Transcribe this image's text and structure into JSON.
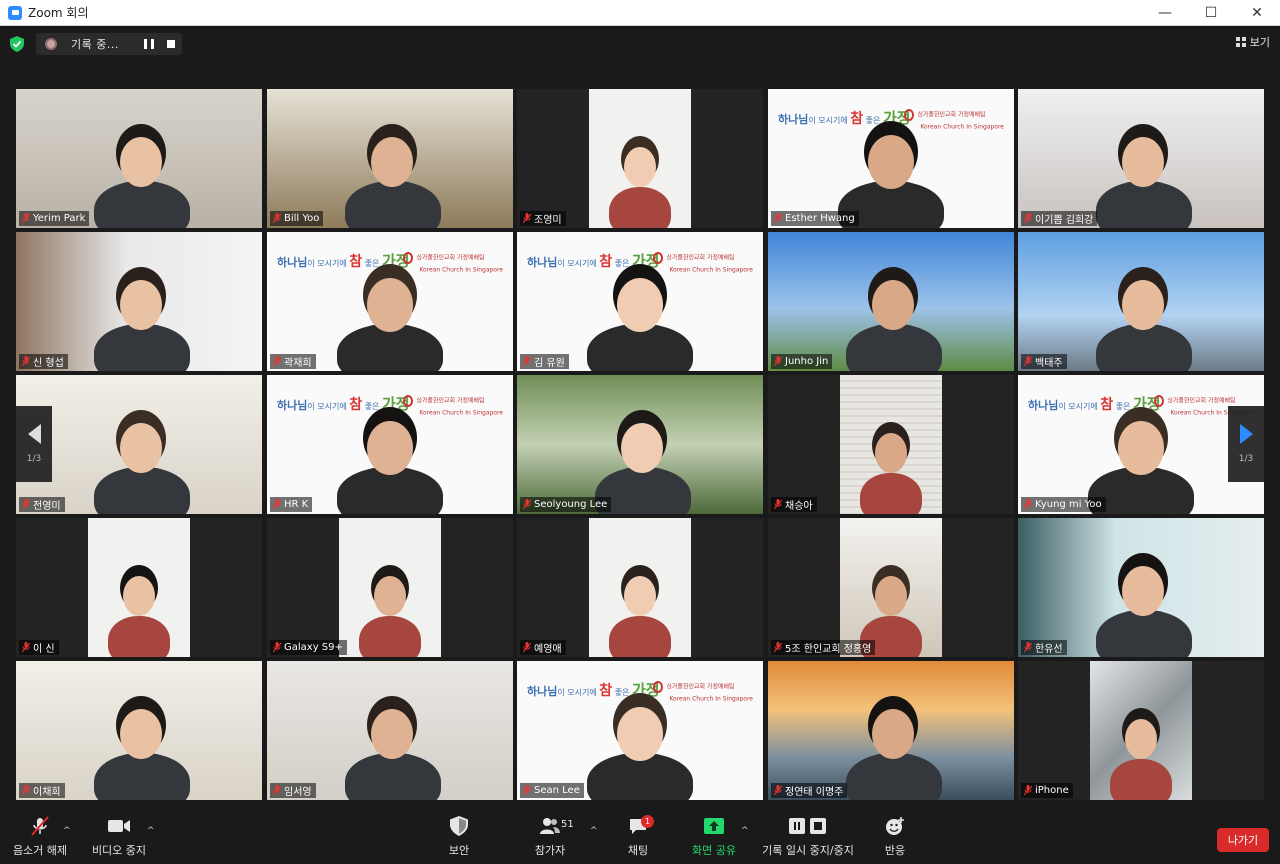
{
  "window": {
    "title": "Zoom 회의",
    "minimize": "—",
    "maximize": "☐",
    "close": "✕"
  },
  "topbar": {
    "recording_text": "기록 중...",
    "view_label": "보기"
  },
  "pager": {
    "left_page": "1/3",
    "right_page": "1/3"
  },
  "tiles": [
    {
      "name": "Yerim Park",
      "style": "room-warm"
    },
    {
      "name": "Bill Yoo",
      "style": "room-office"
    },
    {
      "name": "조영미",
      "style": "narrow-white"
    },
    {
      "name": "Esther Hwang",
      "style": "banner",
      "active": true
    },
    {
      "name": "이기쁨 김희강",
      "style": "room-white"
    },
    {
      "name": "신 형섭",
      "style": "room-shelf"
    },
    {
      "name": "곽재희",
      "style": "banner"
    },
    {
      "name": "김 유원",
      "style": "banner"
    },
    {
      "name": "Junho Jin",
      "style": "sky"
    },
    {
      "name": "백태주",
      "style": "city"
    },
    {
      "name": "전영미",
      "style": "room-bright"
    },
    {
      "name": "HR K",
      "style": "banner"
    },
    {
      "name": "Seolyoung Lee",
      "style": "park"
    },
    {
      "name": "채승아",
      "style": "narrow-blinds"
    },
    {
      "name": "Kyung mi Yoo",
      "style": "banner"
    },
    {
      "name": "이 신",
      "style": "narrow-white"
    },
    {
      "name": "Galaxy S9+",
      "style": "narrow-white"
    },
    {
      "name": "예영애",
      "style": "narrow-white"
    },
    {
      "name": "5조 한인교회 정홍영",
      "style": "narrow-room"
    },
    {
      "name": "한유선",
      "style": "room-window"
    },
    {
      "name": "이채희",
      "style": "room-bright"
    },
    {
      "name": "임서영",
      "style": "room-plain"
    },
    {
      "name": "Sean Lee",
      "style": "banner"
    },
    {
      "name": "정연태 이명주",
      "style": "bridge"
    },
    {
      "name": "iPhone",
      "style": "narrow-glass"
    }
  ],
  "banner": {
    "text_part1": "하나님",
    "text_part2": "이 모시기에 ",
    "text_part3": "참",
    "text_part4": " 좋은 ",
    "text_part5": "가정",
    "logo_line1": "싱가폴한인교회 가정예배팀",
    "logo_line2": "Korean Church In Singapore"
  },
  "toolbar": {
    "unmute": "음소거 해제",
    "stop_video": "비디오 중지",
    "security": "보안",
    "participants": "참가자",
    "participants_count": "51",
    "chat": "채팅",
    "chat_badge": "1",
    "share_screen": "화면 공유",
    "pause_stop_recording": "기록 일시 중지/중지",
    "reactions": "반응",
    "leave": "나가기"
  },
  "colors": {
    "accent_blue": "#2d8cff",
    "active_speaker": "#e8e45a",
    "share_green": "#23d96b",
    "leave_red": "#d92b2b"
  }
}
